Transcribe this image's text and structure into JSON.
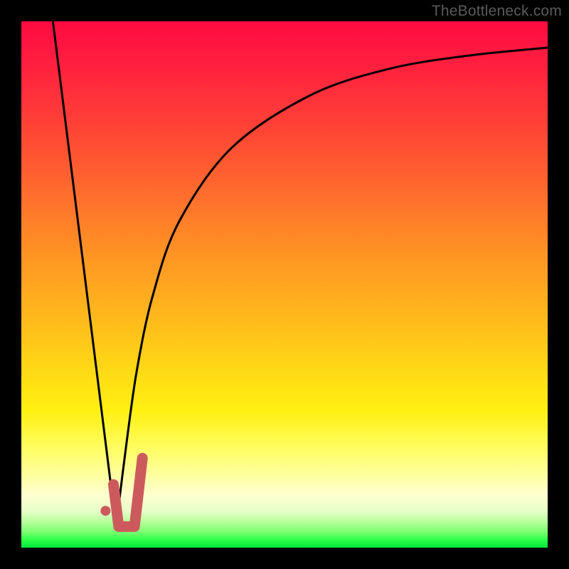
{
  "watermark": "TheBottleneck.com",
  "chart_data": {
    "type": "line",
    "title": "",
    "xlabel": "",
    "ylabel": "",
    "xlim": [
      0,
      100
    ],
    "ylim": [
      0,
      100
    ],
    "series": [
      {
        "name": "left-slope",
        "x": [
          6,
          18
        ],
        "y": [
          100,
          4
        ]
      },
      {
        "name": "right-curve",
        "x": [
          18,
          20,
          22,
          25,
          30,
          40,
          55,
          70,
          85,
          100
        ],
        "y": [
          4,
          20,
          34,
          48,
          62,
          76,
          86,
          91,
          93.5,
          95
        ]
      }
    ],
    "markers": [
      {
        "name": "dot",
        "x": 16,
        "y": 7
      }
    ],
    "hook": {
      "x": [
        17.5,
        18.5,
        21.5,
        23
      ],
      "y": [
        12,
        4,
        4,
        17
      ]
    },
    "colors": {
      "curve": "#000000",
      "hook": "#cc5a5d",
      "gradient_top": "#ff0a40",
      "gradient_bottom": "#00e838"
    }
  }
}
